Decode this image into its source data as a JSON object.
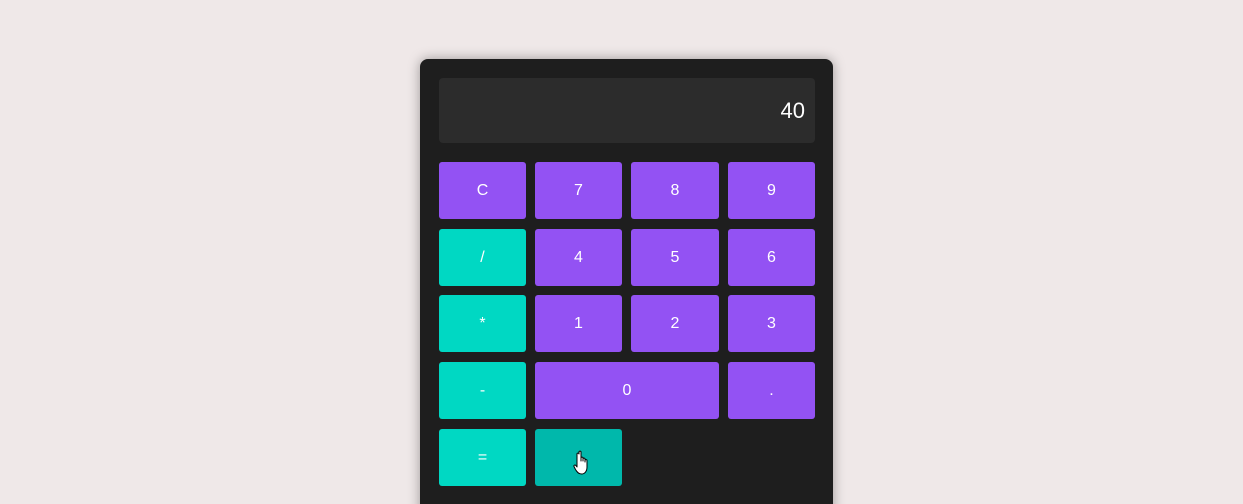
{
  "display": {
    "value": "40"
  },
  "keys": {
    "clear": "C",
    "seven": "7",
    "eight": "8",
    "nine": "9",
    "divide": "/",
    "four": "4",
    "five": "5",
    "six": "6",
    "multiply": "*",
    "one": "1",
    "two": "2",
    "three": "3",
    "subtract": "-",
    "zero": "0",
    "decimal": ".",
    "equals": "=",
    "add": ""
  },
  "colors": {
    "page_background": "#efe8e8",
    "calculator_body": "#1e1e1e",
    "display_background": "#2c2c2c",
    "number_key": "#9352f3",
    "operator_key": "#00d8c3",
    "operator_key_hover": "#00b8ab"
  },
  "icons": {
    "cursor": "hand-pointer-icon"
  }
}
